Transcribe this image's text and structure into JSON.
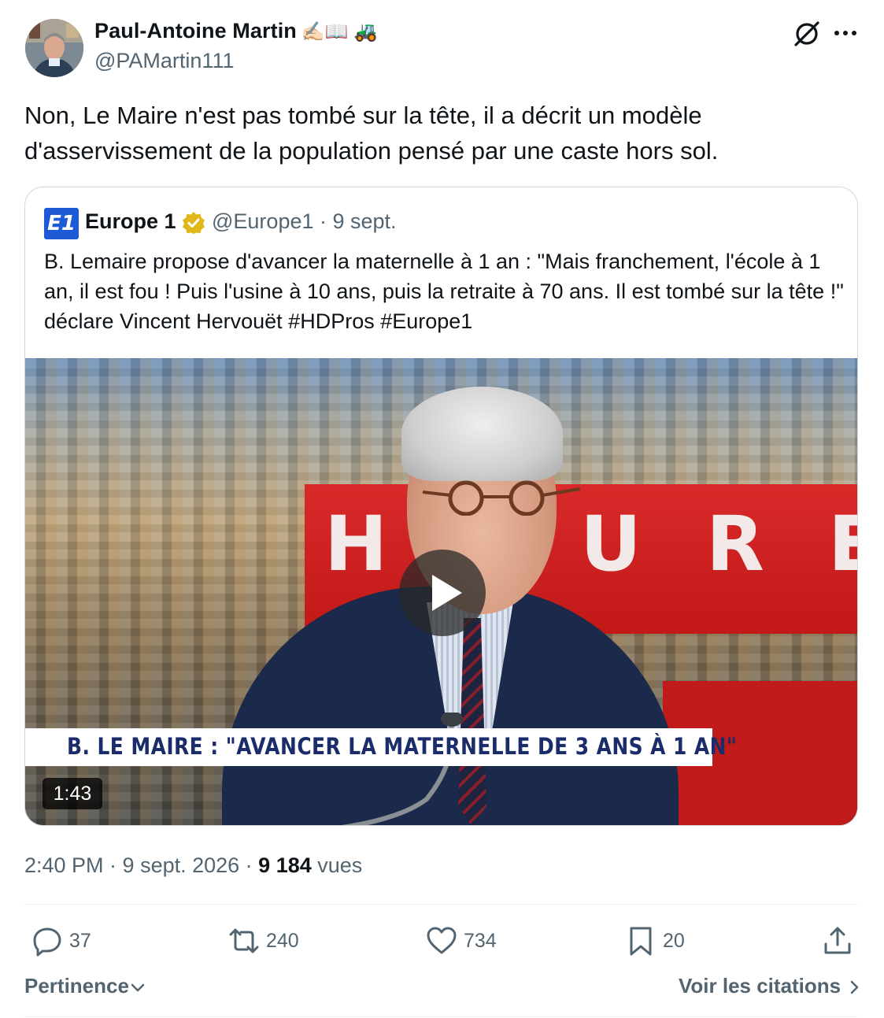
{
  "author": {
    "name": "Paul-Antoine Martin",
    "name_emojis": "✍🏻📖 🚜",
    "handle": "@PAMartin111"
  },
  "tweet": {
    "text": "Non, Le Maire n'est pas tombé sur la tête, il a décrit un modèle d'asservissement de la population pensé par une caste hors sol."
  },
  "quote": {
    "logo_text": "E1",
    "name": "Europe 1",
    "meta": "@Europe1 · 9 sept.",
    "text": "B. Lemaire propose d'avancer la maternelle à 1 an : \"Mais franchement, l'école à 1 an, il est fou ! Puis l'usine à 10 ans, puis la retraite à 70 ans. Il est tombé sur la tête !\" déclare  Vincent Hervouët #HDPros #Europe1",
    "video": {
      "banner_letters": [
        "H",
        "U",
        "R",
        "E"
      ],
      "lower_third": "B. LE MAIRE : \"AVANCER LA MATERNELLE DE 3 ANS À 1 AN\"",
      "duration": "1:43"
    }
  },
  "meta": {
    "time": "2:40 PM · 9 sept. 2026 · ",
    "views_count": "9 184",
    "views_label": " vues"
  },
  "actions": {
    "replies": "37",
    "reposts": "240",
    "likes": "734",
    "bookmarks": "20"
  },
  "footer": {
    "sort_label": "Pertinence",
    "citations_label": "Voir les citations"
  },
  "colors": {
    "text": "#0f1419",
    "secondary": "#536471",
    "border": "#cfd9de",
    "verified_gold": "#e2b719",
    "banner_red": "#c11818",
    "lower_third_text": "#1b2c6b"
  }
}
